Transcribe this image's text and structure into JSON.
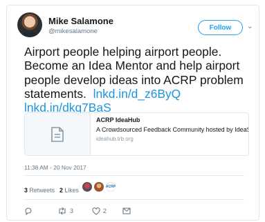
{
  "user": {
    "name": "Mike Salamone",
    "handle": "@mikesalamone"
  },
  "follow_label": "Follow",
  "tweet": {
    "text": "Airport people helping airport people. Become an Idea Mentor and help airport people develop ideas into ACRP problem statements.",
    "link1": "lnkd.in/d_z6ByQ",
    "link2": "lnkd.in/dkq7BaS"
  },
  "link_card": {
    "title": "ACRP IdeaHub",
    "description": "A Crowdsourced Feedback Community hosted by IdeaScale.com",
    "domain": "ideahub.trb.org"
  },
  "timestamp": "11:38 AM - 20 Nov 2017",
  "stats": {
    "retweets_count": "3",
    "retweets_label": "Retweets",
    "likes_count": "2",
    "likes_label": "Likes",
    "likers_badge": "ACRP"
  },
  "actions": {
    "retweet_count": "3",
    "like_count": "2"
  },
  "colors": {
    "accent": "#1da1f2",
    "link": "#1b95e0",
    "muted": "#657786",
    "border": "#e1e8ed"
  },
  "icons": [
    "reply-icon",
    "retweet-icon",
    "like-icon",
    "message-icon",
    "chevron-down-icon",
    "document-icon"
  ]
}
